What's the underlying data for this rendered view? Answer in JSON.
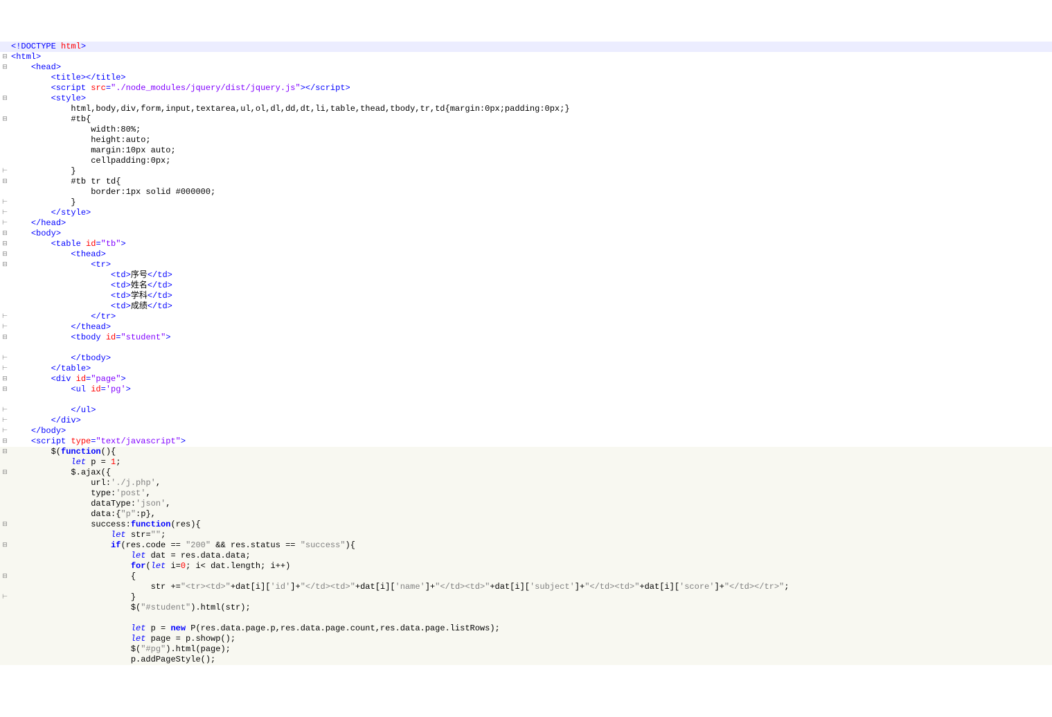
{
  "lines": [
    {
      "g": "",
      "cls": "hl-top",
      "html": "<span class='tag'>&lt;!DOCTYPE</span> <span class='attr'>html</span><span class='tag'>&gt;</span>"
    },
    {
      "g": "⊟",
      "cls": "",
      "html": "<span class='tag'>&lt;html&gt;</span>"
    },
    {
      "g": "⊟",
      "cls": "",
      "html": "    <span class='tag'>&lt;head&gt;</span>"
    },
    {
      "g": "",
      "cls": "",
      "html": "        <span class='tag'>&lt;title&gt;&lt;/title&gt;</span>"
    },
    {
      "g": "",
      "cls": "",
      "html": "        <span class='tag'>&lt;script</span> <span class='attr'>src</span><span class='tag'>=</span><span class='val'>\"./node_modules/jquery/dist/jquery.js\"</span><span class='tag'>&gt;&lt;/script&gt;</span>"
    },
    {
      "g": "⊟",
      "cls": "",
      "html": "        <span class='tag'>&lt;style&gt;</span>"
    },
    {
      "g": "",
      "cls": "",
      "html": "            <span class='txt'>html,body,div,form,input,textarea,ul,ol,dl,dd,dt,li,table,thead,tbody,tr,td{margin:0px;padding:0px;}</span>"
    },
    {
      "g": "⊟",
      "cls": "",
      "html": "            <span class='txt'>#tb{</span>"
    },
    {
      "g": "",
      "cls": "",
      "html": "                <span class='txt'>width:80%;</span>"
    },
    {
      "g": "",
      "cls": "",
      "html": "                <span class='txt'>height:auto;</span>"
    },
    {
      "g": "",
      "cls": "",
      "html": "                <span class='txt'>margin:10px auto;</span>"
    },
    {
      "g": "",
      "cls": "",
      "html": "                <span class='txt'>cellpadding:0px;</span>"
    },
    {
      "g": "⊢",
      "cls": "",
      "html": "            <span class='txt'>}</span>"
    },
    {
      "g": "⊟",
      "cls": "",
      "html": "            <span class='txt'>#tb tr td{</span>"
    },
    {
      "g": "",
      "cls": "",
      "html": "                <span class='txt'>border:1px solid #000000;</span>"
    },
    {
      "g": "⊢",
      "cls": "",
      "html": "            <span class='txt'>}</span>"
    },
    {
      "g": "⊢",
      "cls": "",
      "html": "        <span class='tag'>&lt;/style&gt;</span>"
    },
    {
      "g": "⊢",
      "cls": "",
      "html": "    <span class='tag'>&lt;/head&gt;</span>"
    },
    {
      "g": "⊟",
      "cls": "",
      "html": "    <span class='tag'>&lt;body&gt;</span>"
    },
    {
      "g": "⊟",
      "cls": "",
      "html": "        <span class='tag'>&lt;table</span> <span class='attr'>id</span><span class='tag'>=</span><span class='val'>\"tb\"</span><span class='tag'>&gt;</span>"
    },
    {
      "g": "⊟",
      "cls": "",
      "html": "            <span class='tag'>&lt;thead&gt;</span>"
    },
    {
      "g": "⊟",
      "cls": "",
      "html": "                <span class='tag'>&lt;tr&gt;</span>"
    },
    {
      "g": "",
      "cls": "",
      "html": "                    <span class='tag'>&lt;td&gt;</span><span class='txt cjk'>序号</span><span class='tag'>&lt;/td&gt;</span>"
    },
    {
      "g": "",
      "cls": "",
      "html": "                    <span class='tag'>&lt;td&gt;</span><span class='txt cjk'>姓名</span><span class='tag'>&lt;/td&gt;</span>"
    },
    {
      "g": "",
      "cls": "",
      "html": "                    <span class='tag'>&lt;td&gt;</span><span class='txt cjk'>学科</span><span class='tag'>&lt;/td&gt;</span>"
    },
    {
      "g": "",
      "cls": "",
      "html": "                    <span class='tag'>&lt;td&gt;</span><span class='txt cjk'>成绩</span><span class='tag'>&lt;/td&gt;</span>"
    },
    {
      "g": "⊢",
      "cls": "",
      "html": "                <span class='tag'>&lt;/tr&gt;</span>"
    },
    {
      "g": "⊢",
      "cls": "",
      "html": "            <span class='tag'>&lt;/thead&gt;</span>"
    },
    {
      "g": "⊟",
      "cls": "",
      "html": "            <span class='tag'>&lt;tbody</span> <span class='attr'>id</span><span class='tag'>=</span><span class='val'>\"student\"</span><span class='tag'>&gt;</span>"
    },
    {
      "g": "",
      "cls": "",
      "html": ""
    },
    {
      "g": "⊢",
      "cls": "",
      "html": "            <span class='tag'>&lt;/tbody&gt;</span>"
    },
    {
      "g": "⊢",
      "cls": "",
      "html": "        <span class='tag'>&lt;/table&gt;</span>"
    },
    {
      "g": "⊟",
      "cls": "",
      "html": "        <span class='tag'>&lt;div</span> <span class='attr'>id</span><span class='tag'>=</span><span class='val'>\"page\"</span><span class='tag'>&gt;</span>"
    },
    {
      "g": "⊟",
      "cls": "",
      "html": "            <span class='tag'>&lt;ul</span> <span class='attr'>id</span><span class='tag'>=</span><span class='val'>'pg'</span><span class='tag'>&gt;</span>"
    },
    {
      "g": "",
      "cls": "",
      "html": ""
    },
    {
      "g": "⊢",
      "cls": "",
      "html": "            <span class='tag'>&lt;/ul&gt;</span>"
    },
    {
      "g": "⊢",
      "cls": "",
      "html": "        <span class='tag'>&lt;/div&gt;</span>"
    },
    {
      "g": "⊢",
      "cls": "",
      "html": "    <span class='tag'>&lt;/body&gt;</span>"
    },
    {
      "g": "⊟",
      "cls": "",
      "html": "    <span class='tag'>&lt;script</span> <span class='attr'>type</span><span class='tag'>=</span><span class='val'>\"text/javascript\"</span><span class='tag'>&gt;</span>"
    },
    {
      "g": "⊟",
      "cls": "hl-js",
      "html": "        $(<span class='kw'>function</span>(){"
    },
    {
      "g": "",
      "cls": "hl-js",
      "html": "            <span class='kw2'>let</span> p = <span class='num'>1</span>;"
    },
    {
      "g": "⊟",
      "cls": "hl-js",
      "html": "            $.ajax({"
    },
    {
      "g": "",
      "cls": "hl-js",
      "html": "                url:<span class='str'>'./j.php'</span>,"
    },
    {
      "g": "",
      "cls": "hl-js",
      "html": "                type:<span class='str'>'post'</span>,"
    },
    {
      "g": "",
      "cls": "hl-js",
      "html": "                dataType:<span class='str'>'json'</span>,"
    },
    {
      "g": "",
      "cls": "hl-js",
      "html": "                data:{<span class='str'>\"p\"</span>:p},"
    },
    {
      "g": "⊟",
      "cls": "hl-js",
      "html": "                success:<span class='kw'>function</span>(res){"
    },
    {
      "g": "",
      "cls": "hl-js",
      "html": "                    <span class='kw2'>let</span> str=<span class='str'>\"\"</span>;"
    },
    {
      "g": "⊟",
      "cls": "hl-js",
      "html": "                    <span class='kw'>if</span>(res.code == <span class='str'>\"200\"</span> &amp;&amp; res.status == <span class='str'>\"success\"</span>){"
    },
    {
      "g": "",
      "cls": "hl-js",
      "html": "                        <span class='kw2'>let</span> dat = res.data.data;"
    },
    {
      "g": "",
      "cls": "hl-js",
      "html": "                        <span class='kw'>for</span>(<span class='kw2'>let</span> i=<span class='num'>0</span>; i&lt; dat.length; i++)"
    },
    {
      "g": "⊟",
      "cls": "hl-js",
      "html": "                        {"
    },
    {
      "g": "",
      "cls": "hl-js",
      "html": "                            str +=<span class='str'>\"&lt;tr&gt;&lt;td&gt;\"</span>+dat[i][<span class='str'>'id'</span>]+<span class='str'>\"&lt;/td&gt;&lt;td&gt;\"</span>+dat[i][<span class='str'>'name'</span>]+<span class='str'>\"&lt;/td&gt;&lt;td&gt;\"</span>+dat[i][<span class='str'>'subject'</span>]+<span class='str'>\"&lt;/td&gt;&lt;td&gt;\"</span>+dat[i][<span class='str'>'score'</span>]+<span class='str'>\"&lt;/td&gt;&lt;/tr&gt;\"</span>;"
    },
    {
      "g": "⊢",
      "cls": "hl-js",
      "html": "                        }"
    },
    {
      "g": "",
      "cls": "hl-js",
      "html": "                        $(<span class='str'>\"#student\"</span>).html(str);"
    },
    {
      "g": "",
      "cls": "hl-js",
      "html": ""
    },
    {
      "g": "",
      "cls": "hl-js",
      "html": "                        <span class='kw2'>let</span> p = <span class='kw'>new</span> P(res.data.page.p,res.data.page.count,res.data.page.listRows);"
    },
    {
      "g": "",
      "cls": "hl-js",
      "html": "                        <span class='kw2'>let</span> page = p.showp();"
    },
    {
      "g": "",
      "cls": "hl-js",
      "html": "                        $(<span class='str'>\"#pg\"</span>).html(page);"
    },
    {
      "g": "",
      "cls": "hl-js",
      "html": "                        p.addPageStyle();"
    }
  ]
}
